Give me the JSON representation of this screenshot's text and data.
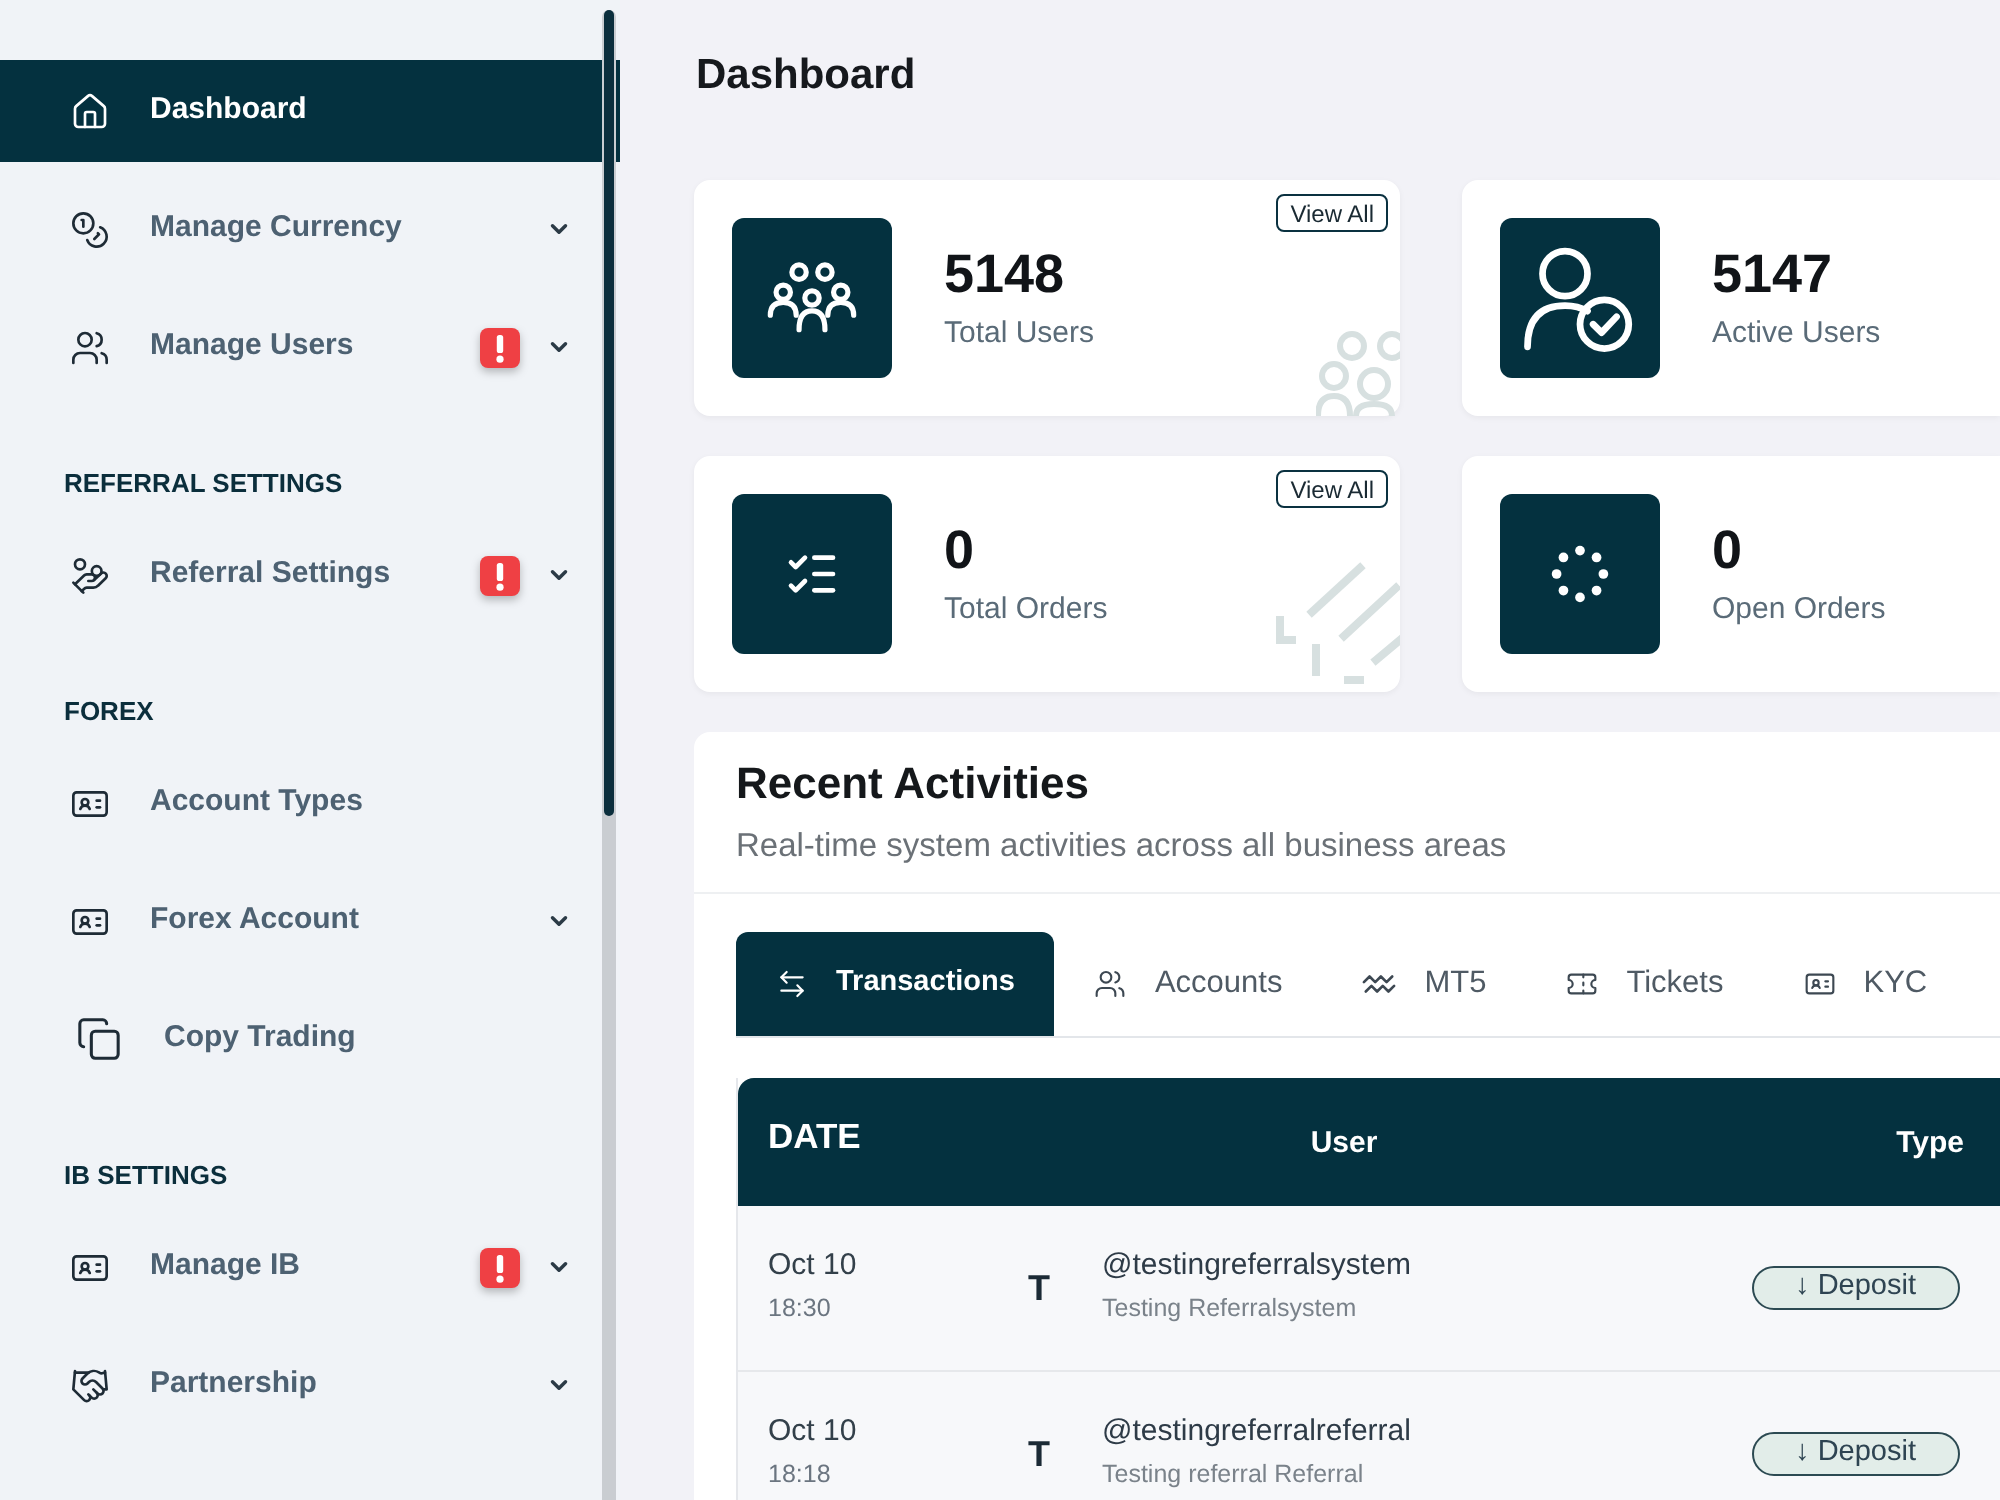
{
  "sidebar": {
    "groups": [
      {
        "items": [
          {
            "label": "Dashboard",
            "selected": true,
            "alert": false,
            "submenu": false
          },
          {
            "label": "Manage Currency",
            "selected": false,
            "alert": false,
            "submenu": true
          },
          {
            "label": "Manage Users",
            "selected": false,
            "alert": true,
            "submenu": true
          }
        ]
      },
      {
        "heading": "REFERRAL SETTINGS",
        "items": [
          {
            "label": "Referral Settings",
            "selected": false,
            "alert": true,
            "submenu": true
          }
        ]
      },
      {
        "heading": "FOREX",
        "items": [
          {
            "label": "Account Types",
            "selected": false,
            "alert": false,
            "submenu": false
          },
          {
            "label": "Forex Account",
            "selected": false,
            "alert": false,
            "submenu": true
          },
          {
            "label": "Copy Trading",
            "selected": false,
            "alert": false,
            "submenu": false
          }
        ]
      },
      {
        "heading": "IB SETTINGS",
        "items": [
          {
            "label": "Manage IB",
            "selected": false,
            "alert": true,
            "submenu": true
          },
          {
            "label": "Partnership",
            "selected": false,
            "alert": false,
            "submenu": true
          }
        ]
      }
    ]
  },
  "page": {
    "title": "Dashboard"
  },
  "stats": [
    {
      "value": "5148",
      "label": "Total Users",
      "action": "View All"
    },
    {
      "value": "5147",
      "label": "Active Users"
    },
    {
      "value": "0",
      "label": "Total Orders",
      "action": "View All"
    },
    {
      "value": "0",
      "label": "Open Orders"
    }
  ],
  "recent_activities": {
    "title": "Recent Activities",
    "subtitle": "Real-time system activities across all business areas",
    "tabs": [
      {
        "label": "Transactions",
        "selected": true
      },
      {
        "label": "Accounts",
        "selected": false
      },
      {
        "label": "MT5",
        "selected": false
      },
      {
        "label": "Tickets",
        "selected": false
      },
      {
        "label": "KYC",
        "selected": false
      }
    ],
    "table": {
      "columns": [
        "DATE",
        "User",
        "Type"
      ],
      "rows": [
        {
          "date": "Oct 10",
          "time": "18:30",
          "initial": "T",
          "username": "@testingreferralsystem",
          "name": "Testing Referralsystem",
          "type": "↓ Deposit"
        },
        {
          "date": "Oct 10",
          "time": "18:18",
          "initial": "T",
          "username": "@testingreferralreferral",
          "name": "Testing referral Referral",
          "type": "↓ Deposit"
        }
      ]
    }
  }
}
